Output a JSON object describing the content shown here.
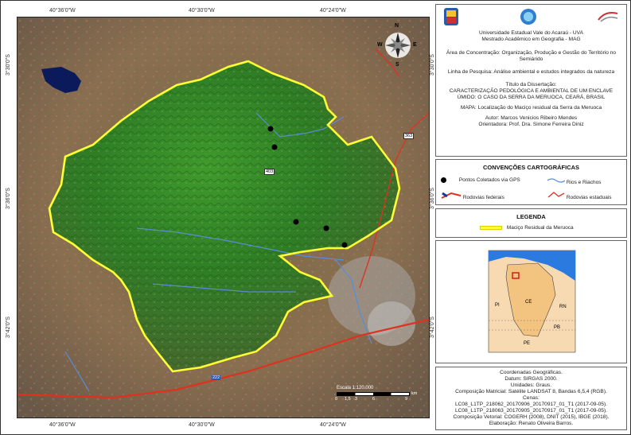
{
  "coords": {
    "top": [
      "40°36'0\"W",
      "40°30'0\"W",
      "40°24'0\"W"
    ],
    "bottom": [
      "40°36'0\"W",
      "40°30'0\"W",
      "40°24'0\"W"
    ],
    "left": [
      "3°30'0\"S",
      "3°36'0\"S",
      "3°42'0\"S"
    ],
    "right": [
      "3°30'0\"S",
      "3°36'0\"S",
      "3°42'0\"S"
    ]
  },
  "map": {
    "north_letters": {
      "n": "N",
      "s": "S",
      "e": "E",
      "w": "W"
    },
    "road_shields": [
      "403",
      "222",
      "363"
    ],
    "scale_text": "Escala 1:120.000",
    "scale_ticks": [
      "0",
      "1,5",
      "3",
      "6",
      "9"
    ],
    "scale_unit": "km"
  },
  "header": {
    "university": "Universidade Estadual Vale do Acaraú - UVA",
    "program": "Mestrado Acadêmico em Geografia - MAG",
    "area": "Área de Concentração: Organização, Produção e Gestão do Território no Semiárido",
    "line": "Linha de Pesquisa: Análise ambiental e estudos integrados da natureza",
    "thesis_label": "Título da Dissertação:",
    "thesis_title": "CARACTERIZAÇÃO PEDOLÓGICA E AMBIENTAL DE UM ENCLAVE ÚMIDO: O CASO DA SERRA DA MERUOCA, CEARÁ, BRASIL",
    "map_title": "MAPA: Localização do Maciço residual da Serra da Meruoca",
    "author": "Autor: Marcos Venicios Ribeiro Mendes",
    "advisor": "Orientadora: Prof. Dra. Simone Ferreira Diniz"
  },
  "conventions": {
    "title": "CONVENÇÕES CARTOGRÁFICAS",
    "items": [
      "Pontos Coletados via GPS",
      "Rios e Riachos",
      "Rodovias federais",
      "Rodovias estaduais"
    ]
  },
  "legend": {
    "title": "LEGENDA",
    "item": "Maciço Residual da Meruoca"
  },
  "inset": {
    "labels": [
      "CE",
      "PI",
      "RN",
      "PB",
      "PE"
    ]
  },
  "footer": {
    "lines": [
      "Coordenadas Geográficas.",
      "Datum: SIRGAS 2000.",
      "Unidades: Graus.",
      "Composição Matricial: Satélite LANDSAT 8, Bandas 6,5,4 (RGB).",
      "Cenas:",
      "LC08_L1TP_218062_20170906_20170917_01_T1 (2017-09-05).",
      "LC08_L1TP_218063_20170905_20170917_01_T1 (2017-09-05).",
      "Composição Vetorial: COGERH (2008), DNIT (2015), IBGE (2018).",
      "Elaboração: Renato Oliveira Barros."
    ]
  },
  "colors": {
    "massif": "#ffff33",
    "federal": "#e03020",
    "state": "#e03020",
    "river": "#5a8cd8",
    "points": "#000000"
  }
}
